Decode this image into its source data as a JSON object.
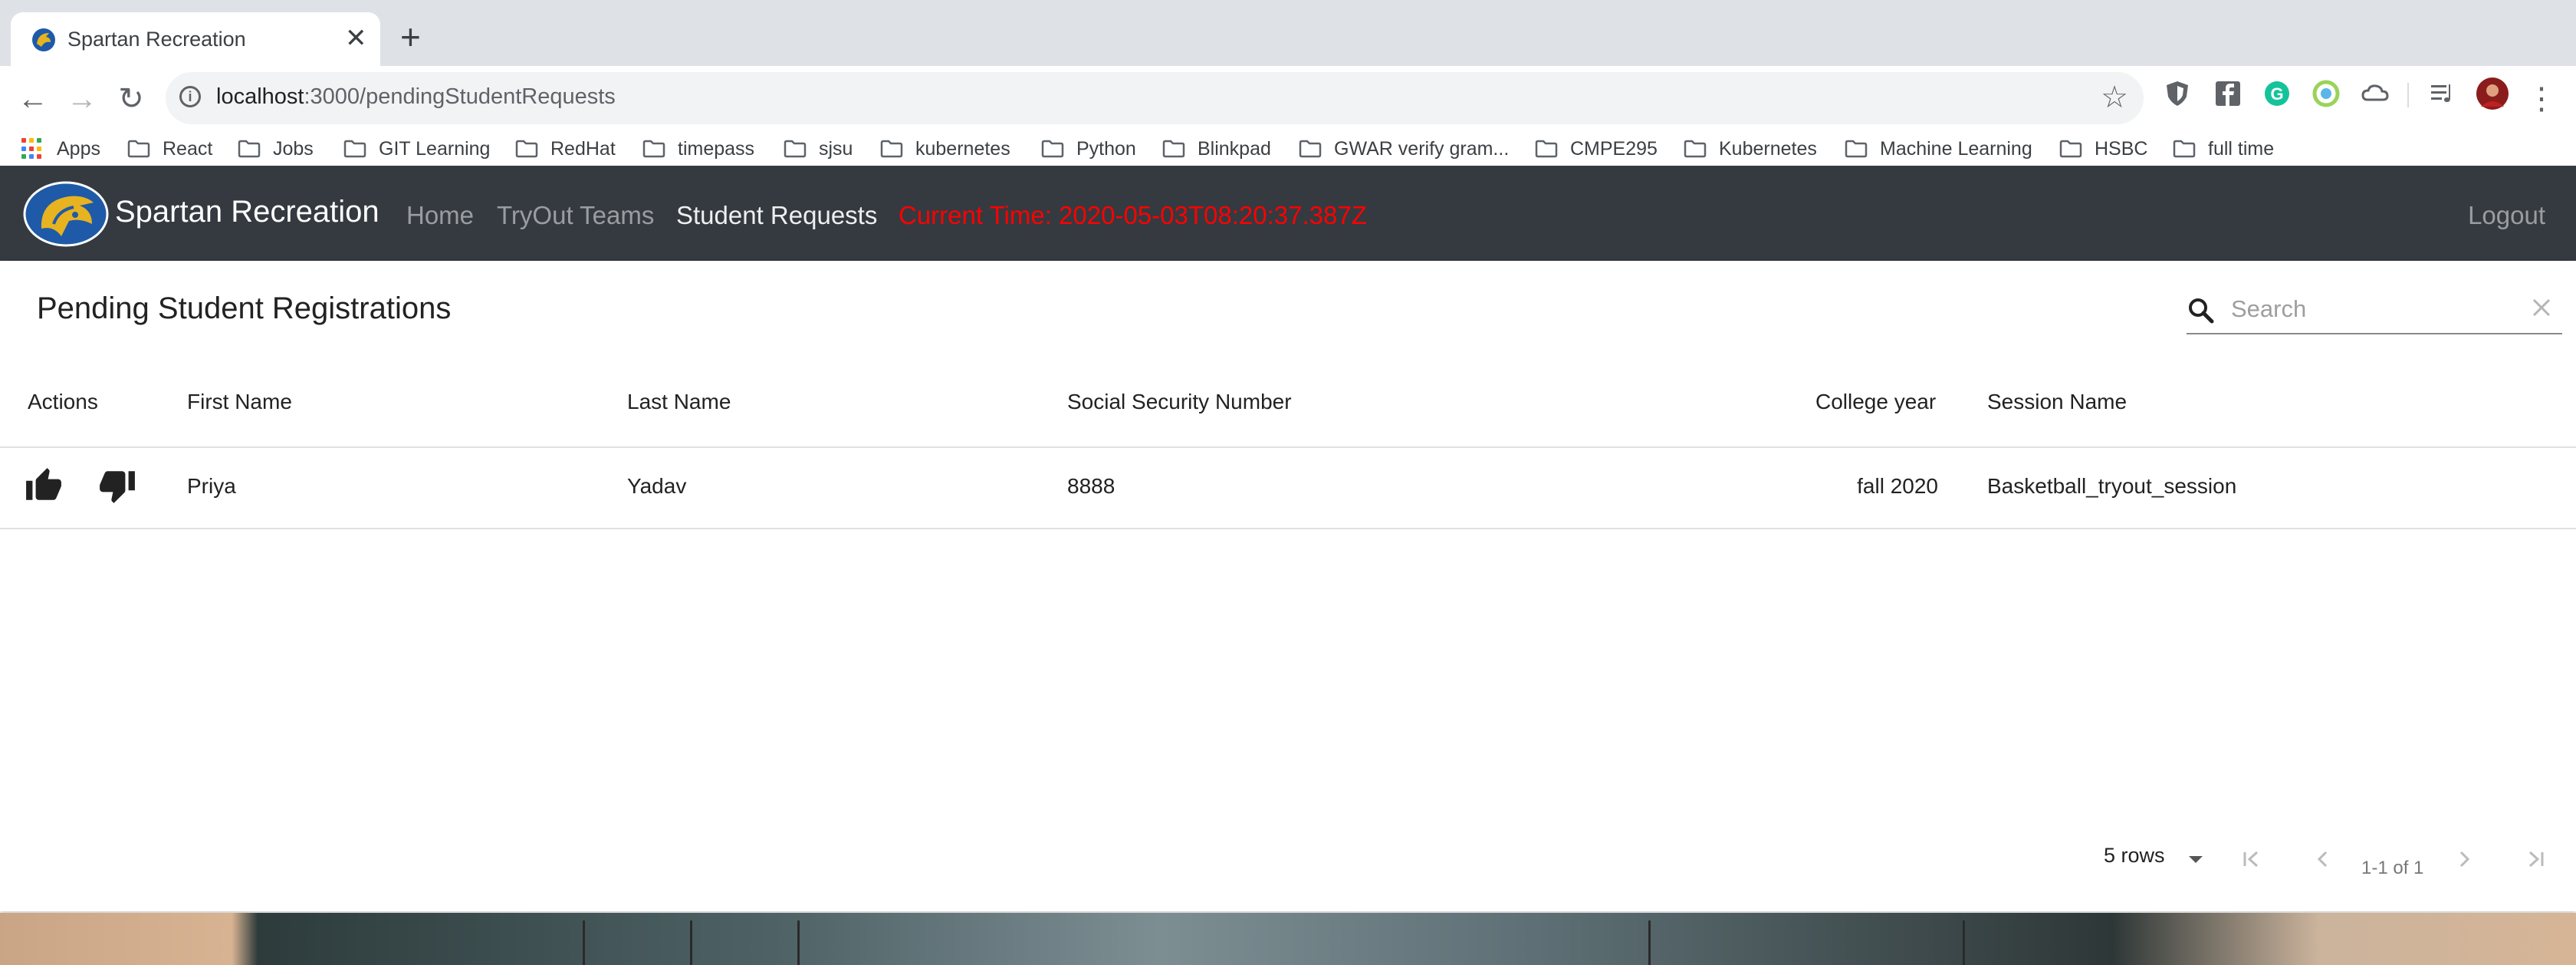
{
  "browser": {
    "tab_title": "Spartan Recreation",
    "url_host": "localhost",
    "url_path": ":3000/pendingStudentRequests",
    "bookmarks": [
      "Apps",
      "React",
      "Jobs",
      "GIT Learning",
      "RedHat",
      "timepass",
      "sjsu",
      "kubernetes",
      "Python",
      "Blinkpad",
      "GWAR verify gram...",
      "CMPE295",
      "Kubernetes",
      "Machine Learning",
      "HSBC",
      "full time"
    ]
  },
  "navbar": {
    "brand": "Spartan Recreation",
    "links": [
      "Home",
      "TryOut Teams",
      "Student Requests"
    ],
    "current_time": "Current Time: 2020-05-03T08:20:37.387Z",
    "logout": "Logout"
  },
  "table": {
    "title": "Pending Student Registrations",
    "search_placeholder": "Search",
    "columns": [
      "Actions",
      "First Name",
      "Last Name",
      "Social Security Number",
      "College year",
      "Session Name"
    ],
    "rows": [
      {
        "first_name": "Priya",
        "last_name": "Yadav",
        "ssn": "8888",
        "college_year": "fall 2020",
        "session_name": "Basketball_tryout_session"
      }
    ],
    "pagination": {
      "rows_per_page": "5 rows",
      "count": "1-1 of 1"
    }
  },
  "colors": {
    "navbar_bg": "#343a40",
    "current_time": "#ff0000",
    "tab_strip": "#dee1e6"
  }
}
